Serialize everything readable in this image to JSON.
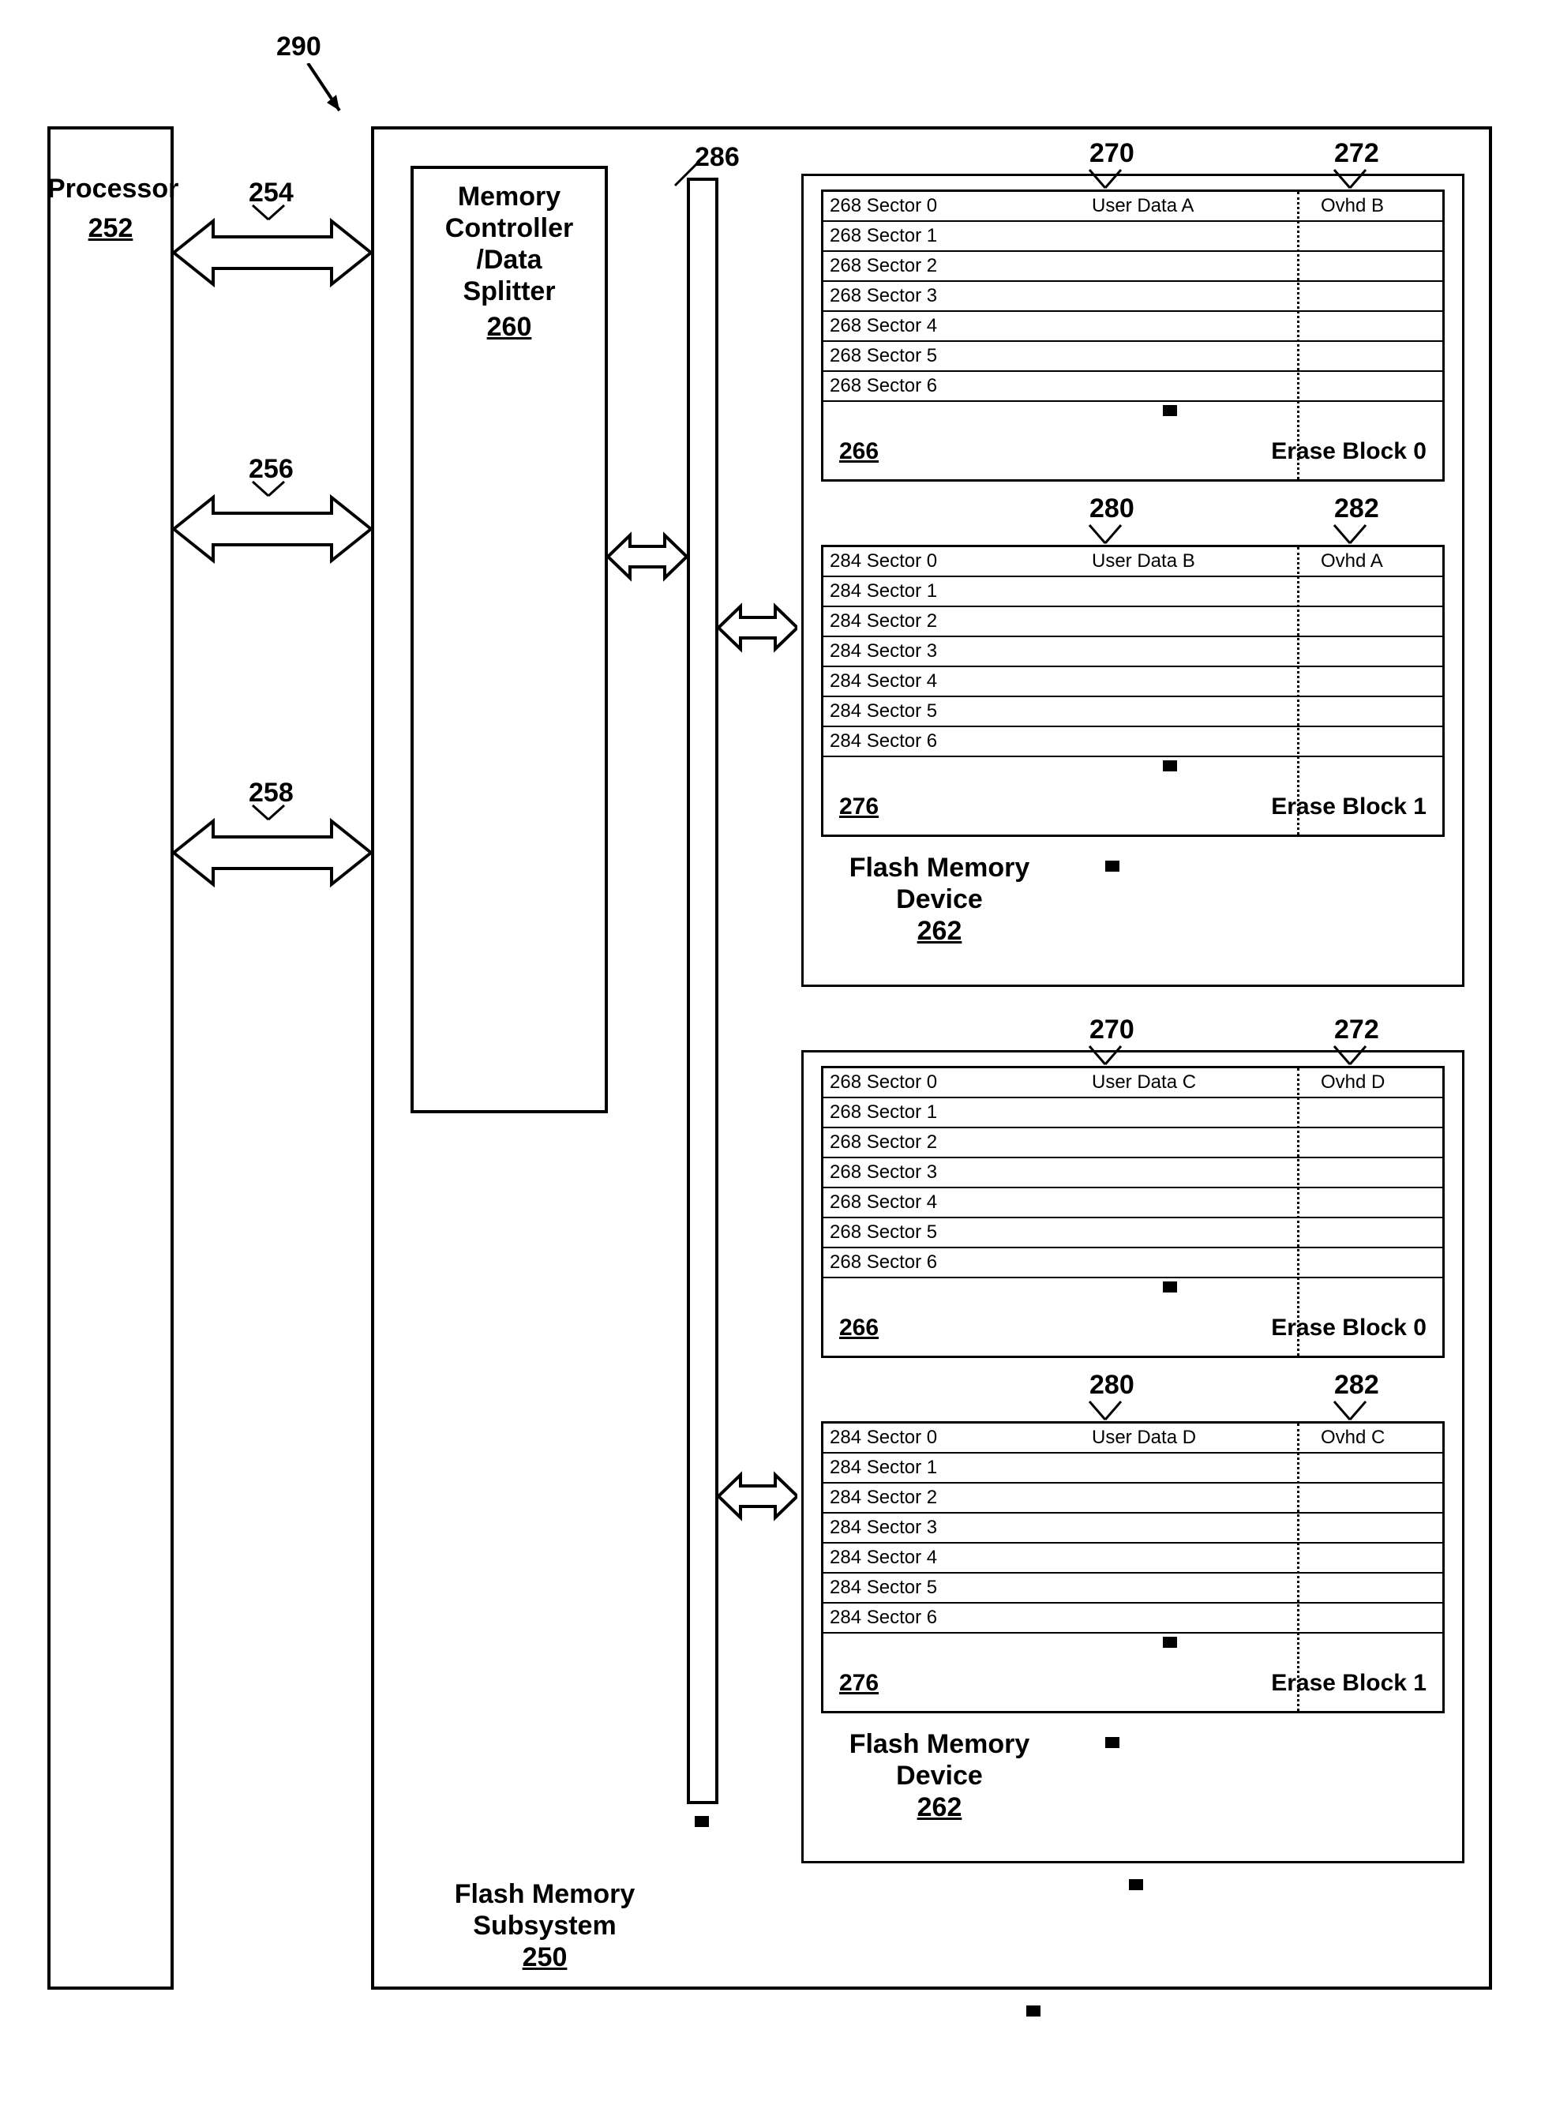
{
  "refs": {
    "system": "290",
    "processor": "Processor",
    "processor_num": "252",
    "arrow1": "254",
    "arrow2": "256",
    "arrow3": "258",
    "controller_l1": "Memory",
    "controller_l2": "Controller",
    "controller_l3": "/Data",
    "controller_l4": "Splitter",
    "controller_num": "260",
    "bus_num": "286",
    "subsystem_l1": "Flash Memory",
    "subsystem_l2": "Subsystem",
    "subsystem_num": "250",
    "fmd_l1": "Flash Memory",
    "fmd_l2": "Device",
    "fmd_num": "262",
    "col_user": "270",
    "col_ovhd": "272",
    "col_user2": "280",
    "col_ovhd2": "282",
    "eb0_num": "266",
    "eb0_name": "Erase Block 0",
    "eb1_num": "276",
    "eb1_name": "Erase Block 1",
    "devA": {
      "b0_sec_prefix": "268",
      "b0_userdata": "User Data A",
      "b0_ovhd": "Ovhd B",
      "b1_sec_prefix": "284",
      "b1_userdata": "User Data B",
      "b1_ovhd": "Ovhd A"
    },
    "devB": {
      "b0_sec_prefix": "268",
      "b0_userdata": "User Data C",
      "b0_ovhd": "Ovhd D",
      "b1_sec_prefix": "284",
      "b1_userdata": "User Data D",
      "b1_ovhd": "Ovhd C"
    },
    "sector_word": "Sector"
  }
}
